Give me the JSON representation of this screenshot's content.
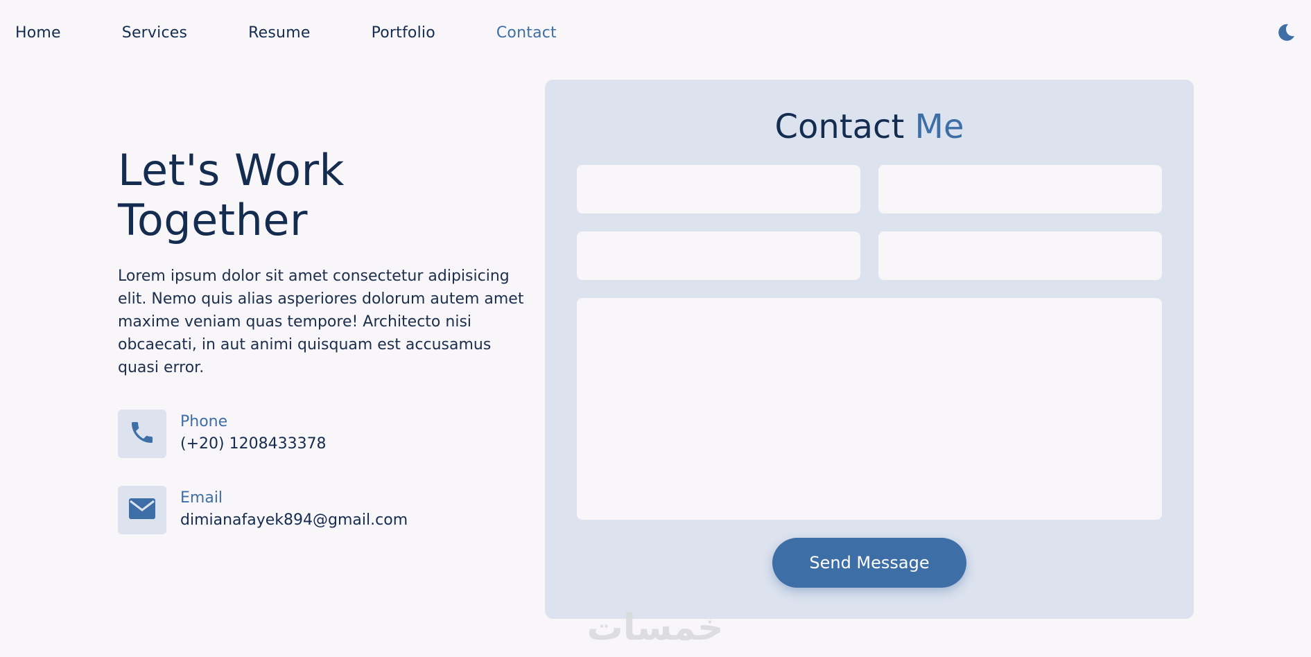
{
  "nav": {
    "items": [
      {
        "label": "Home"
      },
      {
        "label": "Services"
      },
      {
        "label": "Resume"
      },
      {
        "label": "Portfolio"
      },
      {
        "label": "Contact",
        "active": true
      }
    ],
    "theme_toggle_icon": "moon-icon"
  },
  "hero": {
    "headline_line1": "Let's Work",
    "headline_line2": "Together",
    "intro": "Lorem ipsum dolor sit amet consectetur adipisicing elit. Nemo quis alias asperiores dolorum autem amet maxime veniam quas tempore! Architecto nisi obcaecati, in aut animi quisquam est accusamus quasi error."
  },
  "contact_info": [
    {
      "icon": "phone-icon",
      "label": "Phone",
      "value": "(+20) 1208433378"
    },
    {
      "icon": "envelope-icon",
      "label": "Email",
      "value": "dimianafayek894@gmail.com"
    }
  ],
  "form": {
    "title_main": "Contact",
    "title_accent": "Me",
    "fields": [
      {
        "value": "",
        "placeholder": ""
      },
      {
        "value": "",
        "placeholder": ""
      },
      {
        "value": "",
        "placeholder": ""
      },
      {
        "value": "",
        "placeholder": ""
      }
    ],
    "message": {
      "value": "",
      "placeholder": ""
    },
    "submit_label": "Send Message"
  },
  "watermark": {
    "text": "خمسات"
  },
  "colors": {
    "background": "#f8f6f8",
    "primary_text": "#142c4f",
    "accent": "#3e6ea6",
    "card_bg": "#dce2ee"
  }
}
